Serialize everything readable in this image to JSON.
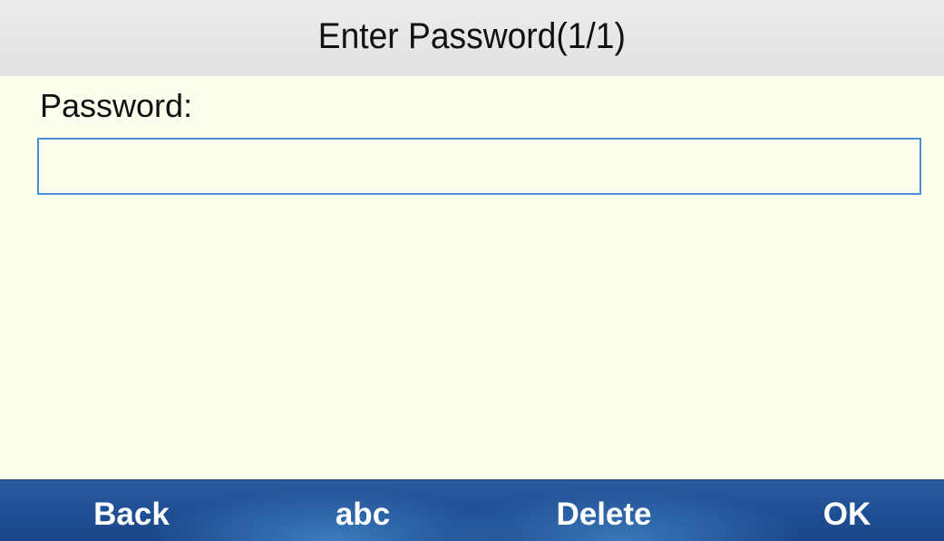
{
  "title_bar": {
    "title": "Enter Password(1/1)"
  },
  "form": {
    "password_label": "Password:",
    "password_value": "",
    "password_placeholder": ""
  },
  "softkeys": [
    {
      "label": "Back"
    },
    {
      "label": "abc"
    },
    {
      "label": "Delete"
    },
    {
      "label": "OK"
    }
  ],
  "colors": {
    "title_bar_bg": "#e6e6e6",
    "content_bg": "#fefeee",
    "input_border": "#4a90d9",
    "softkey_bar_bg": "#1f4f93",
    "softkey_text": "#ffffff"
  }
}
